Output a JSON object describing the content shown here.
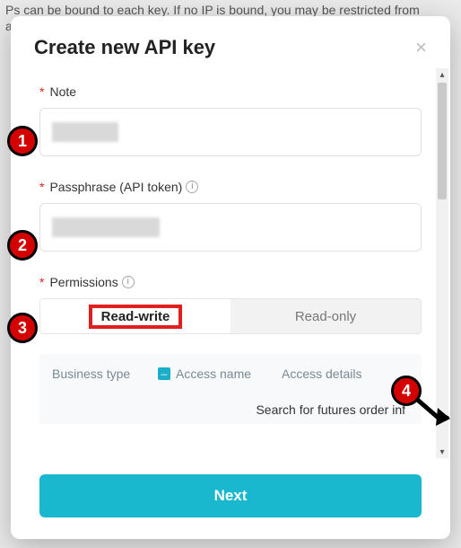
{
  "background_text": "Ps can be bound to each key. If no IP is bound, you may be restricted from accessin",
  "modal": {
    "title": "Create new API key",
    "close_label": "×"
  },
  "note": {
    "label": "Note",
    "value": ""
  },
  "passphrase": {
    "label": "Passphrase (API token)",
    "value": ""
  },
  "permissions": {
    "label": "Permissions",
    "options": {
      "rw": "Read-write",
      "ro": "Read-only"
    },
    "selected": "rw"
  },
  "access": {
    "col_business": "Business type",
    "col_name": "Access name",
    "col_details": "Access details",
    "row_detail": "Search for futures order inf"
  },
  "footer": {
    "next": "Next"
  },
  "callouts": {
    "c1": "1",
    "c2": "2",
    "c3": "3",
    "c4": "4"
  },
  "colors": {
    "accent": "#1ab8cf",
    "danger": "#e02020"
  }
}
